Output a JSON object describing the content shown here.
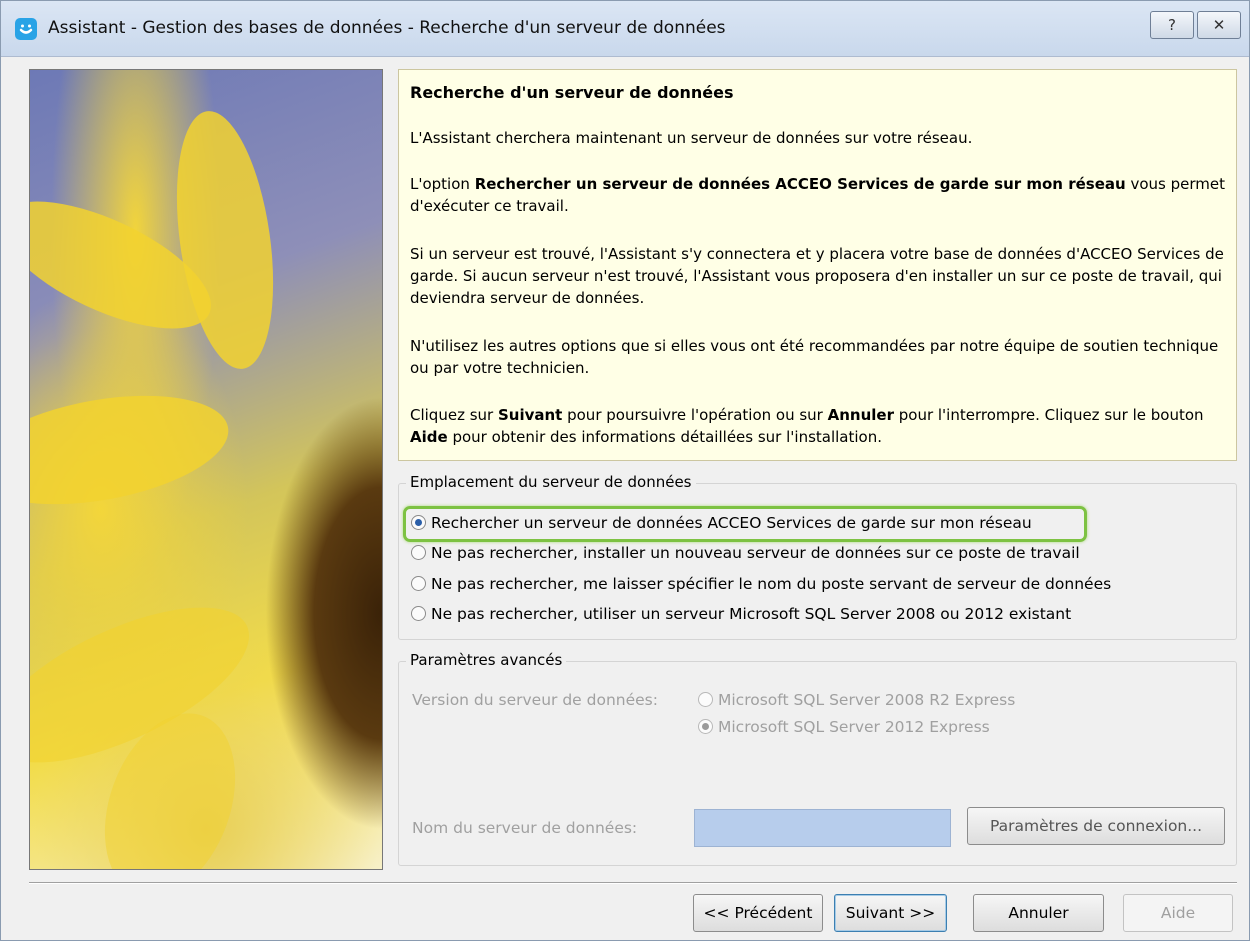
{
  "window": {
    "title": "Assistant - Gestion des bases de données - Recherche d'un serveur de données",
    "help_label": "?",
    "close_label": "✕"
  },
  "info": {
    "heading": "Recherche d'un serveur de données",
    "p1": "L'Assistant cherchera maintenant un serveur de données sur votre réseau.",
    "p2_pre": "L'option ",
    "p2_bold": "Rechercher un serveur de données ACCEO Services de garde sur mon réseau",
    "p2_post": " vous permet d'exécuter ce travail.",
    "p3": "Si un serveur est trouvé, l'Assistant s'y connectera et y placera votre base de données d'ACCEO Services de garde. Si aucun serveur n'est trouvé, l'Assistant vous proposera d'en installer un sur ce poste de travail, qui deviendra serveur de données.",
    "p4": "N'utilisez les autres options que si elles vous ont été recommandées par notre équipe de soutien technique ou par votre technicien.",
    "p5_a": "Cliquez sur ",
    "p5_b": "Suivant",
    "p5_c": " pour poursuivre l'opération ou sur ",
    "p5_d": "Annuler",
    "p5_e": " pour l'interrompre. Cliquez sur le bouton ",
    "p5_f": "Aide",
    "p5_g": " pour obtenir des informations détaillées sur l'installation."
  },
  "location": {
    "legend": "Emplacement du serveur de données",
    "options": [
      {
        "label": "Rechercher un serveur de données ACCEO Services de garde sur mon réseau",
        "checked": true
      },
      {
        "label": "Ne pas rechercher, installer un nouveau serveur de données sur ce poste de travail",
        "checked": false
      },
      {
        "label": "Ne pas rechercher, me laisser spécifier le nom du poste servant de serveur de données",
        "checked": false
      },
      {
        "label": "Ne pas rechercher, utiliser un serveur Microsoft SQL Server 2008 ou 2012 existant",
        "checked": false
      }
    ]
  },
  "advanced": {
    "legend": "Paramètres avancés",
    "version_label": "Version du serveur de données:",
    "version_options": [
      {
        "label": "Microsoft SQL Server 2008 R2 Express",
        "checked": false
      },
      {
        "label": "Microsoft SQL Server 2012 Express",
        "checked": true
      }
    ],
    "server_name_label": "Nom du serveur de données:",
    "server_name_value": "",
    "connection_button": "Paramètres de connexion..."
  },
  "buttons": {
    "previous": "<< Précédent",
    "next": "Suivant >>",
    "cancel": "Annuler",
    "help": "Aide"
  }
}
